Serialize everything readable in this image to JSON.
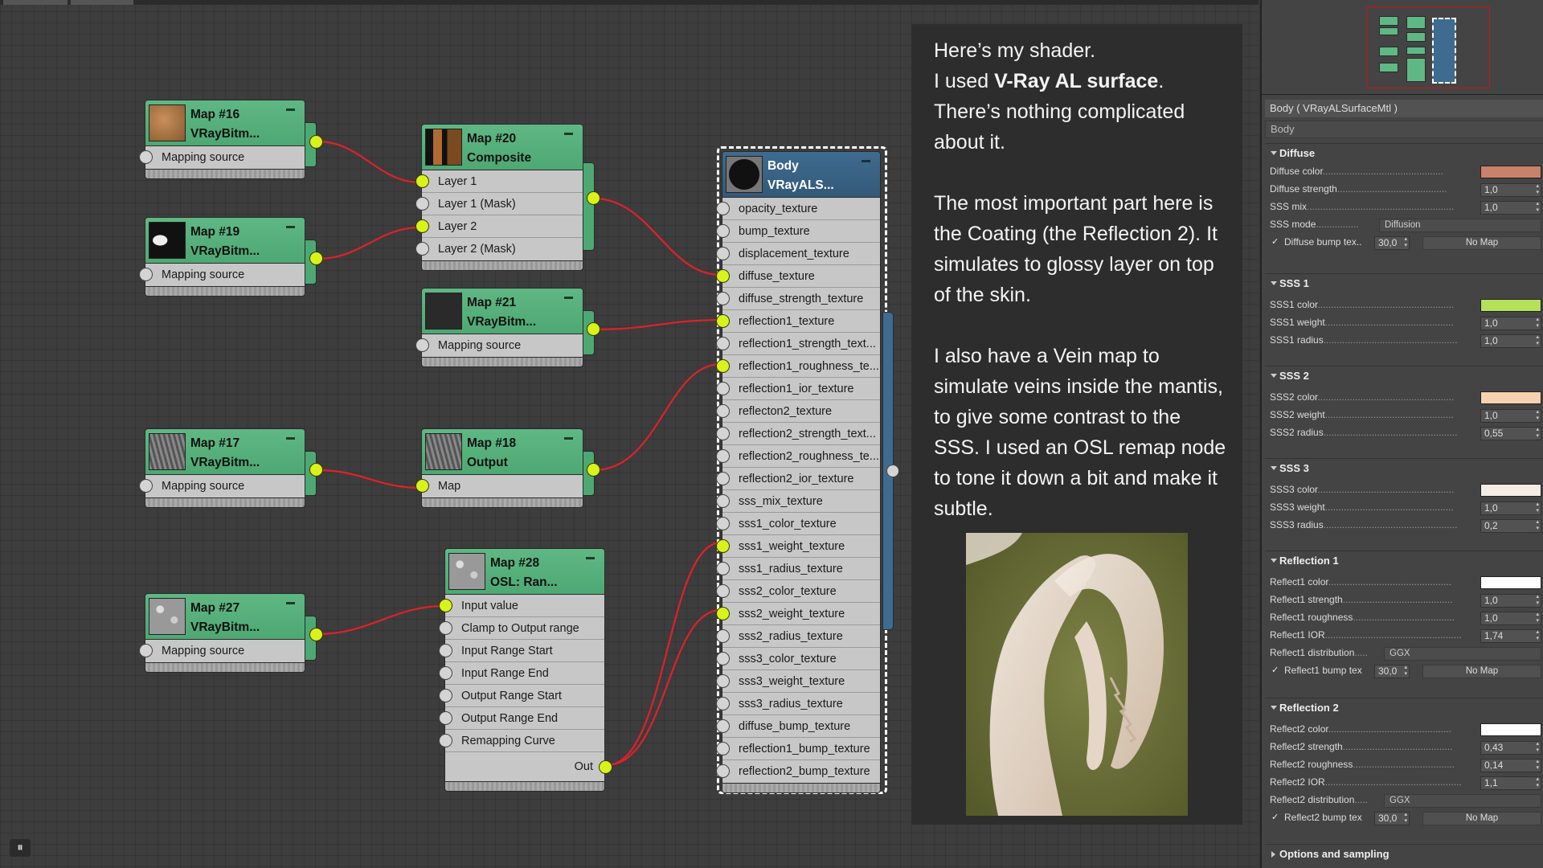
{
  "nodes": {
    "map16": {
      "title1": "Map #16",
      "title2": "VRayBitm...",
      "ports": [
        "Mapping source"
      ]
    },
    "map19": {
      "title1": "Map #19",
      "title2": "VRayBitm...",
      "ports": [
        "Mapping source"
      ]
    },
    "map20": {
      "title1": "Map #20",
      "title2": "Composite",
      "ports": [
        "Layer 1",
        "Layer 1 (Mask)",
        "Layer 2",
        "Layer 2 (Mask)"
      ]
    },
    "map21": {
      "title1": "Map #21",
      "title2": "VRayBitm...",
      "ports": [
        "Mapping source"
      ]
    },
    "map17": {
      "title1": "Map #17",
      "title2": "VRayBitm...",
      "ports": [
        "Mapping source"
      ]
    },
    "map18": {
      "title1": "Map #18",
      "title2": "Output",
      "ports": [
        "Map"
      ]
    },
    "map27": {
      "title1": "Map #27",
      "title2": "VRayBitm...",
      "ports": [
        "Mapping source"
      ]
    },
    "map28": {
      "title1": "Map #28",
      "title2": "OSL:  Ran...",
      "ports": [
        "Input value",
        "Clamp to Output range",
        "Input Range Start",
        "Input Range End",
        "Output Range Start",
        "Output Range End",
        "Remapping Curve"
      ],
      "out_label": "Out"
    },
    "body": {
      "title1": "Body",
      "title2": "VRayALS...",
      "ports": [
        "opacity_texture",
        "bump_texture",
        "displacement_texture",
        "diffuse_texture",
        "diffuse_strength_texture",
        "reflection1_texture",
        "reflection1_strength_text...",
        "reflection1_roughness_te...",
        "reflection1_ior_texture",
        "reflecton2_texture",
        "reflection2_strength_text...",
        "reflection2_roughness_te...",
        "reflection2_ior_texture",
        "sss_mix_texture",
        "sss1_color_texture",
        "sss1_weight_texture",
        "sss1_radius_texture",
        "sss2_color_texture",
        "sss2_weight_texture",
        "sss2_radius_texture",
        "sss3_color_texture",
        "sss3_weight_texture",
        "sss3_radius_texture",
        "diffuse_bump_texture",
        "reflection1_bump_texture",
        "reflection2_bump_texture"
      ]
    }
  },
  "notes": {
    "p1_a": "Here’s my shader.",
    "p1_b_pre": "I used ",
    "p1_b_bold": "V-Ray AL surface",
    "p1_b_post": ".",
    "p1_c": "There’s nothing complicated about it.",
    "p2": "The most important part here is the Coating (the Reflection 2). It simulates to glossy layer on top of the skin.",
    "p3": "I also have a Vein map to simulate veins inside the mantis, to give some contrast to the SSS. I used an OSL remap node to tone it down a bit and make it subtle."
  },
  "panel": {
    "title": "Body  ( VRayALSurfaceMtl )",
    "name": "Body",
    "sections": {
      "diffuse": {
        "header": "Diffuse",
        "color_label": "Diffuse color",
        "color": "#c8826a",
        "strength_label": "Diffuse strength",
        "strength": "1,0",
        "sssmix_label": "SSS mix",
        "sssmix": "1,0",
        "sssmode_label": "SSS mode",
        "sssmode": "Diffusion",
        "bump_label": "Diffuse bump tex",
        "bump": "30,0",
        "nomap": "No Map"
      },
      "sss1": {
        "header": "SSS 1",
        "color_label": "SSS1 color",
        "color": "#b4e05a",
        "weight_label": "SSS1 weight",
        "weight": "1,0",
        "radius_label": "SSS1 radius",
        "radius": "1,0"
      },
      "sss2": {
        "header": "SSS 2",
        "color_label": "SSS2 color",
        "color": "#f6d2b0",
        "weight_label": "SSS2 weight",
        "weight": "1,0",
        "radius_label": "SSS2 radius",
        "radius": "0,55"
      },
      "sss3": {
        "header": "SSS 3",
        "color_label": "SSS3 color",
        "color": "#f6ece6",
        "weight_label": "SSS3 weight",
        "weight": "1,0",
        "radius_label": "SSS3 radius",
        "radius": "0,2"
      },
      "refl1": {
        "header": "Reflection 1",
        "color_label": "Reflect1 color",
        "color": "#ffffff",
        "strength_label": "Reflect1 strength",
        "strength": "1,0",
        "rough_label": "Reflect1 roughness",
        "rough": "1,0",
        "ior_label": "Reflect1 IOR",
        "ior": "1,74",
        "dist_label": "Reflect1 distribution",
        "dist": "GGX",
        "bump_label": "Reflect1 bump tex",
        "bump": "30,0",
        "nomap": "No Map"
      },
      "refl2": {
        "header": "Reflection 2",
        "color_label": "Reflect2 color",
        "color": "#ffffff",
        "strength_label": "Reflect2 strength",
        "strength": "0,43",
        "rough_label": "Reflect2 roughness",
        "rough": "0,14",
        "ior_label": "Reflect2 IOR",
        "ior": "1,1",
        "dist_label": "Reflect2 distribution",
        "dist": "GGX",
        "bump_label": "Reflect2 bump tex",
        "bump": "30,0",
        "nomap": "No Map"
      },
      "options": {
        "header": "Options and sampling"
      }
    }
  },
  "colors": {
    "node_green": "#4ea873",
    "node_blue": "#3f6b8e",
    "wire": "#e0202a",
    "port_active": "#d8f21c"
  },
  "icons": {
    "bottom": "navigation-icon"
  }
}
